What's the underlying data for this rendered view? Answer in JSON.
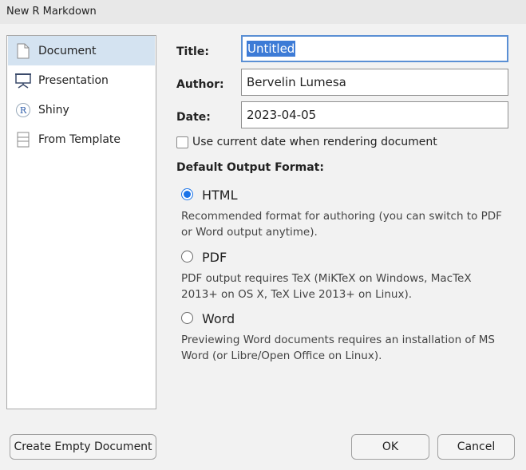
{
  "window": {
    "title": "New R Markdown"
  },
  "doc_types": [
    {
      "label": "Document",
      "icon": "document-icon",
      "selected": true
    },
    {
      "label": "Presentation",
      "icon": "presentation-icon",
      "selected": false
    },
    {
      "label": "Shiny",
      "icon": "shiny-r-icon",
      "selected": false
    },
    {
      "label": "From Template",
      "icon": "template-icon",
      "selected": false
    }
  ],
  "form": {
    "title_label": "Title:",
    "title_value": "Untitled",
    "author_label": "Author:",
    "author_value": "Bervelin Lumesa",
    "date_label": "Date:",
    "date_value": "2023-04-05",
    "use_current_date_label": "Use current date when rendering document",
    "use_current_date_checked": false
  },
  "output": {
    "heading": "Default Output Format:",
    "options": [
      {
        "label": "HTML",
        "checked": true,
        "description": "Recommended format for authoring (you can switch to PDF or Word output anytime)."
      },
      {
        "label": "PDF",
        "checked": false,
        "description": "PDF output requires TeX (MiKTeX on Windows, MacTeX 2013+ on OS X, TeX Live 2013+ on Linux)."
      },
      {
        "label": "Word",
        "checked": false,
        "description": "Previewing Word documents requires an installation of MS Word (or Libre/Open Office on Linux)."
      }
    ]
  },
  "buttons": {
    "create_empty": "Create Empty Document",
    "ok": "OK",
    "cancel": "Cancel"
  },
  "colors": {
    "selection": "#d4e3f1",
    "text_selection": "#3d7bd6",
    "radio_accent": "#1a73e8",
    "focus_border": "#5a8fd4"
  }
}
